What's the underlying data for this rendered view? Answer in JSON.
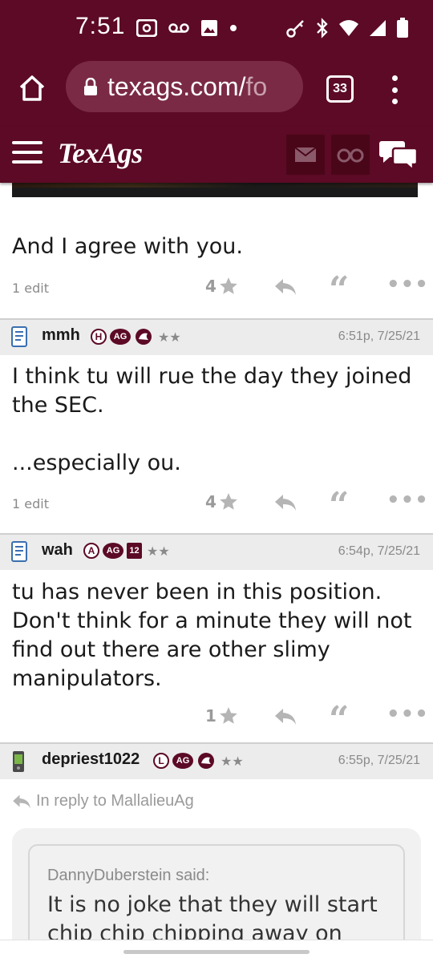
{
  "status_bar": {
    "time": "7:51"
  },
  "browser": {
    "url_main": "texags.com/",
    "url_tail": "fo",
    "tab_count": "33"
  },
  "site": {
    "logo": "TexAgs"
  },
  "posts": [
    {
      "body_lines": [
        "And I agree with you."
      ],
      "edit_note": "1 edit",
      "stars": "4"
    },
    {
      "username": "mmh",
      "badge_letter": "H",
      "badge_ag": "AG",
      "rank_stars": "★★",
      "time": "6:51p, 7/25/21",
      "body_p1": "I think tu will rue the day they joined the SEC.",
      "body_p2": "...especially ou.",
      "edit_note": "1 edit",
      "stars": "4"
    },
    {
      "username": "wah",
      "badge_letter": "A",
      "badge_ag": "AG",
      "badge_12": "12",
      "rank_stars": "★★",
      "time": "6:54p, 7/25/21",
      "body_p1": "tu has never been in this position. Don't think for a minute they will not find out there are other slimy manipulators.",
      "stars": "1"
    },
    {
      "username": "depriest1022",
      "badge_letter": "L",
      "badge_ag": "AG",
      "rank_stars": "★★",
      "time": "6:55p, 7/25/21",
      "reply_to": "In reply to MallalieuAg",
      "quote_author": "DannyDuberstein said:",
      "quote_text": "It is no joke that they will start chip chip chipping away on"
    }
  ],
  "colors": {
    "maroon": "#5c0a25",
    "header_dark": "#4a0619",
    "gray_text": "#8a8a8a"
  }
}
